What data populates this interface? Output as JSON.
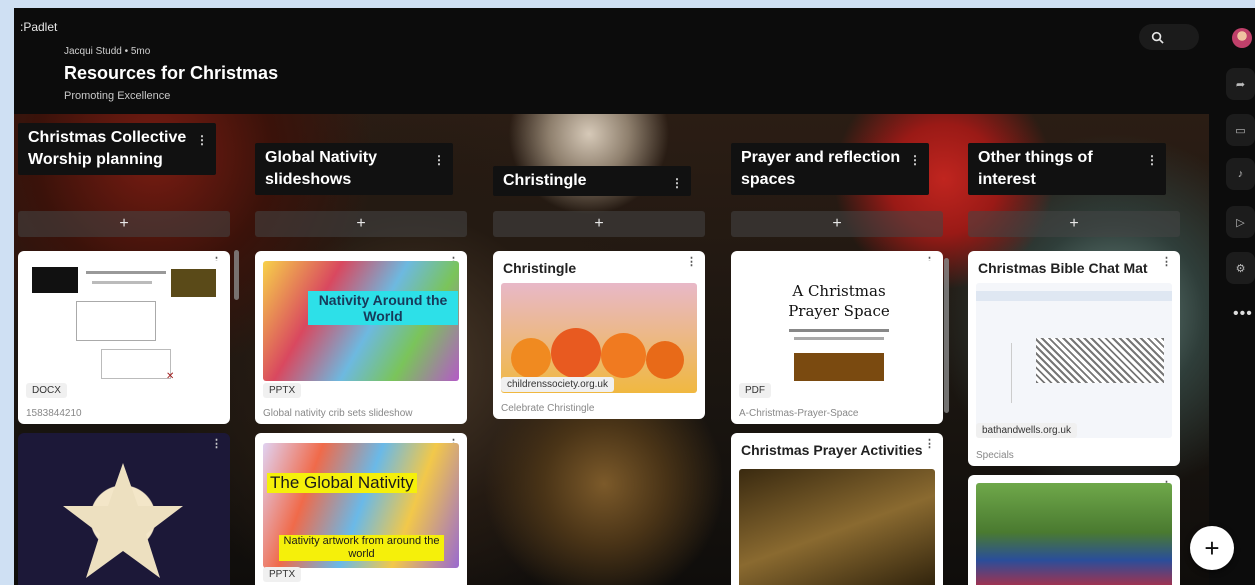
{
  "app": {
    "logo": ":Padlet"
  },
  "header": {
    "author": "Jacqui Studd • 5mo",
    "title": "Resources for Christmas",
    "subtitle": "Promoting Excellence",
    "search_icon": "search-icon"
  },
  "columns": [
    {
      "name": "Christmas Collective Worship planning",
      "add": "+"
    },
    {
      "name": "Global Nativity slideshows",
      "add": "+"
    },
    {
      "name": "Christingle",
      "add": "+"
    },
    {
      "name": "Prayer and reflection spaces",
      "add": "+"
    },
    {
      "name": "Other things of interest",
      "add": "+"
    }
  ],
  "cards": {
    "c1_1": {
      "type": "DOCX",
      "caption": "1583844210"
    },
    "c2_1": {
      "type": "PPTX",
      "caption": "Global nativity crib sets slideshow",
      "thumb_title": "Nativity Around the World"
    },
    "c2_2": {
      "type": "PPTX",
      "thumb_title": "The Global Nativity",
      "thumb_sub": "Nativity artwork from around the world"
    },
    "c3_1": {
      "title": "Christingle",
      "chip": "childrenssociety.org.uk",
      "caption": "Celebrate Christingle"
    },
    "c4_1": {
      "type": "PDF",
      "caption": "A-Christmas-Prayer-Space",
      "thumb_title": "A Christmas Prayer Space"
    },
    "c4_2": {
      "title": "Christmas Prayer Activities"
    },
    "c5_1": {
      "title": "Christmas Bible Chat Mat",
      "chip": "bathandwells.org.uk",
      "caption": "Specials"
    }
  },
  "fab": {
    "label": "+"
  }
}
